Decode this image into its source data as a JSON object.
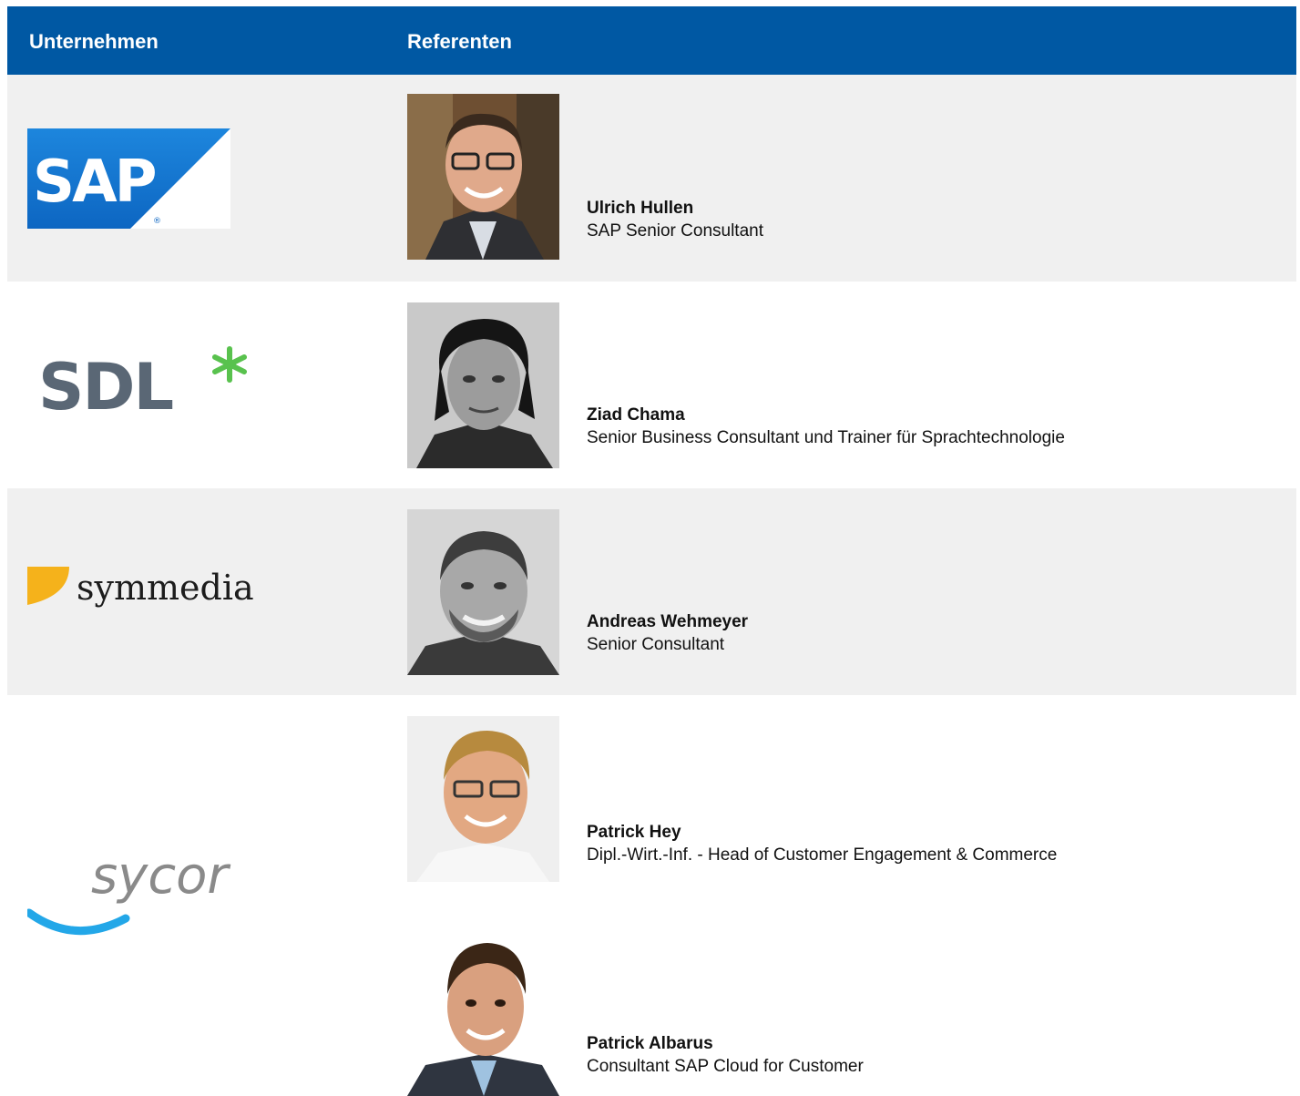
{
  "header": {
    "company_label": "Unternehmen",
    "speakers_label": "Referenten"
  },
  "rows": [
    {
      "company": "SAP",
      "speakers": [
        {
          "name": "Ulrich Hullen",
          "title": "SAP Senior Consultant"
        }
      ]
    },
    {
      "company": "SDL",
      "speakers": [
        {
          "name": "Ziad Chama",
          "title": "Senior Business Consultant und Trainer für Sprachtechnologie"
        }
      ]
    },
    {
      "company": "symmedia",
      "speakers": [
        {
          "name": "Andreas Wehmeyer",
          "title": "Senior Consultant"
        }
      ]
    },
    {
      "company": "sycor",
      "speakers": [
        {
          "name": "Patrick Hey",
          "title": "Dipl.-Wirt.-Inf. - Head of Customer Engagement & Commerce"
        },
        {
          "name": "Patrick Albarus",
          "title": "Consultant SAP Cloud for Customer"
        }
      ]
    }
  ],
  "colors": {
    "header": "#0058a3",
    "row_shade": "#f0f0f0",
    "sap_blue": "#1a7fd6",
    "sdl_grey": "#5a6775",
    "sdl_green": "#59c24e",
    "symmedia_yellow": "#f5b21b",
    "sycor_blue": "#23a7e8",
    "sycor_grey": "#8a8a8a"
  },
  "icons": [
    "sap-logo",
    "sdl-logo",
    "symmedia-logo",
    "sycor-logo",
    "speaker-photo"
  ]
}
